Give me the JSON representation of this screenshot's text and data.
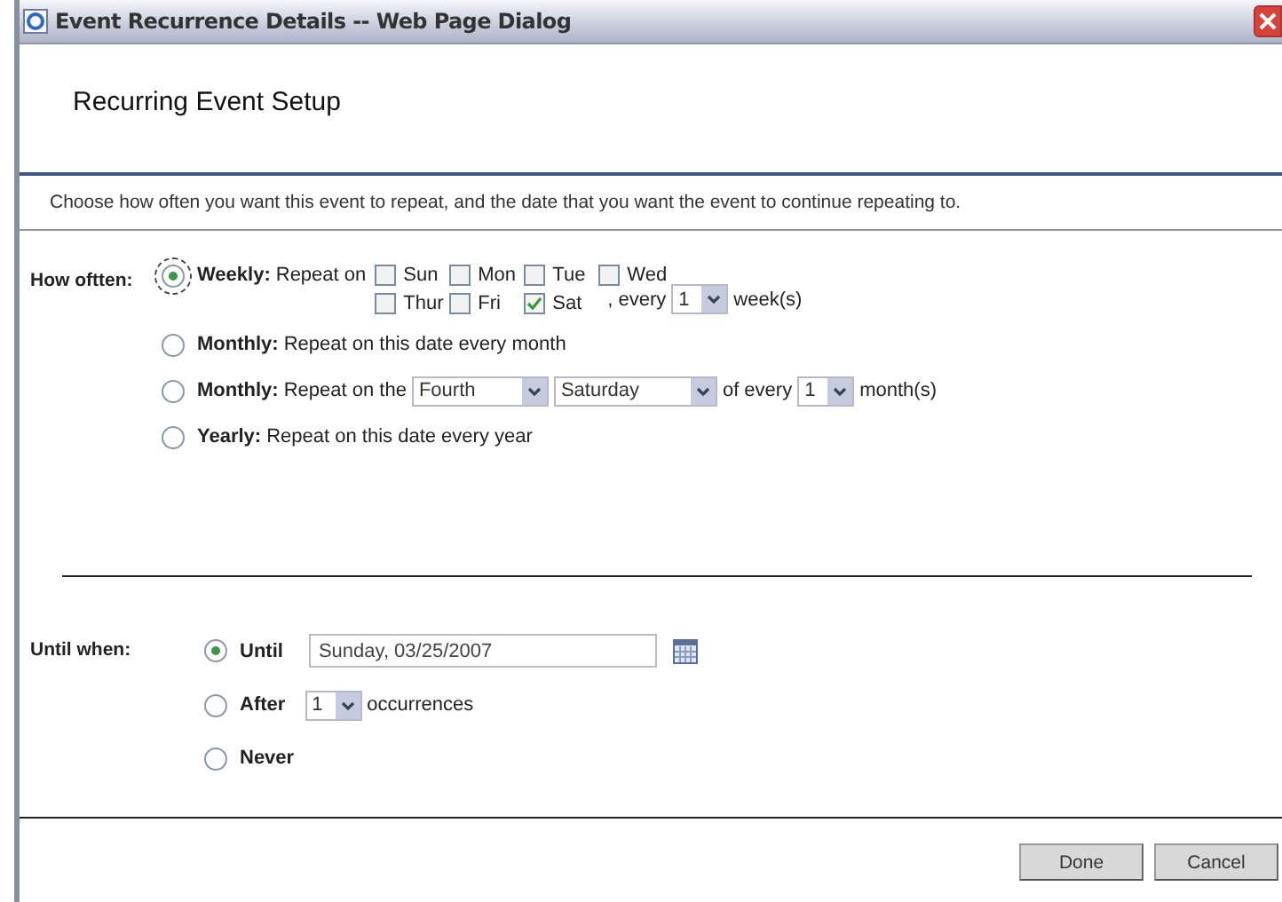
{
  "window": {
    "title": "Event Recurrence Details -- Web Page Dialog"
  },
  "header": {
    "title": "Recurring Event Setup"
  },
  "intro": "Choose how often you want this event to repeat, and the date that you want the event to continue repeating to.",
  "how_often": {
    "label": "How oftten:",
    "options": [
      {
        "kind": "weekly",
        "selected": true,
        "focused": true,
        "label": "Weekly:",
        "text": "Repeat on",
        "days": [
          {
            "label": "Sun",
            "checked": false
          },
          {
            "label": "Mon",
            "checked": false
          },
          {
            "label": "Tue",
            "checked": false
          },
          {
            "label": "Wed",
            "checked": false
          },
          {
            "label": "Thur",
            "checked": false
          },
          {
            "label": "Fri",
            "checked": false
          },
          {
            "label": "Sat",
            "checked": true
          }
        ],
        "every": ", every",
        "interval": "1",
        "unit": "week(s)"
      },
      {
        "kind": "simple",
        "selected": false,
        "focused": false,
        "label": "Monthly:",
        "text": "Repeat on this date every month"
      },
      {
        "kind": "monthly_day",
        "selected": false,
        "focused": false,
        "label": "Monthly:",
        "text": "Repeat on the",
        "week": "Fourth",
        "day": "Saturday",
        "every": "of every",
        "interval": "1",
        "unit": "month(s)"
      },
      {
        "kind": "simple",
        "selected": false,
        "focused": false,
        "label": "Yearly:",
        "text": "Repeat on this date every year"
      }
    ]
  },
  "until_when": {
    "label": "Until when:",
    "options": [
      {
        "kind": "until",
        "selected": true,
        "label": "Until",
        "date": "Sunday, 03/25/2007"
      },
      {
        "kind": "after",
        "selected": false,
        "label": "After",
        "count": "1",
        "unit": "occurrences"
      },
      {
        "kind": "never",
        "selected": false,
        "label": "Never"
      }
    ]
  },
  "buttons": [
    "Done",
    "Cancel"
  ]
}
